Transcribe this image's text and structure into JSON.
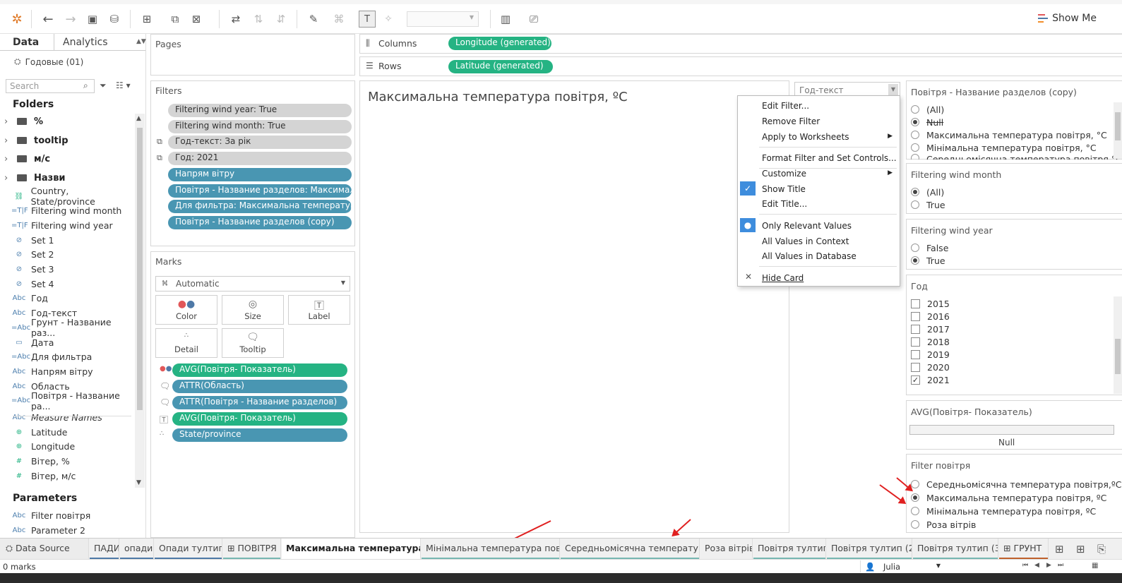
{
  "toolbar": {
    "show_me": "Show Me"
  },
  "data_pane": {
    "tabs": [
      "Data",
      "Analytics"
    ],
    "datasource": "Годовые  (01)",
    "search_placeholder": "Search",
    "folders_header": "Folders",
    "folders": [
      "%",
      "tooltip",
      "м/с",
      "Назви"
    ],
    "fields": [
      {
        "icon": "geo",
        "label": "Country, State/province"
      },
      {
        "icon": "=T|F",
        "label": "Filtering  wind month"
      },
      {
        "icon": "=T|F",
        "label": "Filtering  wind year"
      },
      {
        "icon": "set",
        "label": "Set 1"
      },
      {
        "icon": "set",
        "label": "Set 2"
      },
      {
        "icon": "set",
        "label": "Set 3"
      },
      {
        "icon": "set",
        "label": "Set 4"
      },
      {
        "icon": "Abc",
        "label": "Год"
      },
      {
        "icon": "Abc",
        "label": "Год-текст"
      },
      {
        "icon": "=Abc",
        "label": "Грунт - Название раз..."
      },
      {
        "icon": "date",
        "label": "Дата"
      },
      {
        "icon": "=Abc",
        "label": "Для фильтра"
      },
      {
        "icon": "Abc",
        "label": "Напрям вітру"
      },
      {
        "icon": "Abc",
        "label": "Область"
      },
      {
        "icon": "=Abc",
        "label": "Повітря - Название ра..."
      },
      {
        "icon": "Abc",
        "label": "Measure Names"
      },
      {
        "icon": "globe",
        "label": "Latitude"
      },
      {
        "icon": "globe",
        "label": "Longitude"
      },
      {
        "icon": "#",
        "label": "Вітер, %"
      },
      {
        "icon": "#",
        "label": "Вітер, м/с"
      }
    ],
    "parameters_header": "Parameters",
    "parameters": [
      "Filter повітря",
      "Parameter 2"
    ]
  },
  "pages": {
    "title": "Pages"
  },
  "columns": {
    "label": "Columns",
    "pill": "Longitude (generated)"
  },
  "rows": {
    "label": "Rows",
    "pill": "Latitude (generated)"
  },
  "filters": {
    "title": "Filters",
    "items": [
      "Filtering  wind year: True",
      "Filtering  wind month: True",
      "Год-текст: За рік",
      "Год: 2021",
      "Напрям вітру",
      "Повітря - Название разделов: Максимальн...",
      "Для фильтра: Максимальна температура п...",
      "Повітря - Название разделов (copy)"
    ]
  },
  "marks": {
    "title": "Marks",
    "type": "Automatic",
    "buttons": [
      "Color",
      "Size",
      "Label",
      "Detail",
      "Tooltip"
    ],
    "pills": [
      "AVG(Повітря- Показатель)",
      "ATTR(Область)",
      "ATTR(Повітря - Название разделов)",
      "AVG(Повітря- Показатель)",
      "State/province"
    ]
  },
  "view": {
    "title": "Максимальна температура повітря, ºC"
  },
  "god_text_dropdown": "Год-текст",
  "context_menu": {
    "items": [
      "Edit Filter...",
      "Remove Filter",
      "Apply to Worksheets",
      "Format Filter and Set Controls...",
      "Customize",
      "Show Title",
      "Edit Title...",
      "Only Relevant Values",
      "All Values in Context",
      "All Values in Database",
      "Hide Card"
    ]
  },
  "right_filters": {
    "copy": {
      "title": "Повітря - Название разделов (copy)",
      "options": [
        "(All)",
        "Null",
        "Максимальна температура повітря, °C",
        "Мінімальна температура повітря, °C",
        "Середньомісячна температура повітря,°С"
      ]
    },
    "wind_month": {
      "title": "Filtering  wind month",
      "options": [
        "(All)",
        "True"
      ]
    },
    "wind_year": {
      "title": "Filtering  wind year",
      "options": [
        "False",
        "True"
      ]
    },
    "god": {
      "title": "Год",
      "options": [
        "2015",
        "2016",
        "2017",
        "2018",
        "2019",
        "2020",
        "2021"
      ]
    },
    "avg": {
      "title": "AVG(Повітря- Показатель)",
      "value": "Null"
    },
    "filter_povitrya": {
      "title": "Filter повітря",
      "options": [
        "Середньомісячна температура повітря,ºC",
        "Максимальна температура повітря, ºC",
        "Мінімальна температура повітря, ºC",
        "Роза вітрів"
      ]
    }
  },
  "sheet_tabs": [
    "Data Source",
    "ПАДИ",
    "опади",
    "Опади тултип",
    "ПОВІТРЯ",
    "Максимальна температура п...",
    "Мінімальна температура повіт...",
    "Середньомісячна температура...",
    "Роза вітрів",
    "Повітря тултип",
    "Повітря тултип (2)",
    "Повітря тултип (3)",
    "ГРУНТ"
  ],
  "status": {
    "marks": "0 marks",
    "user": "Julia"
  }
}
